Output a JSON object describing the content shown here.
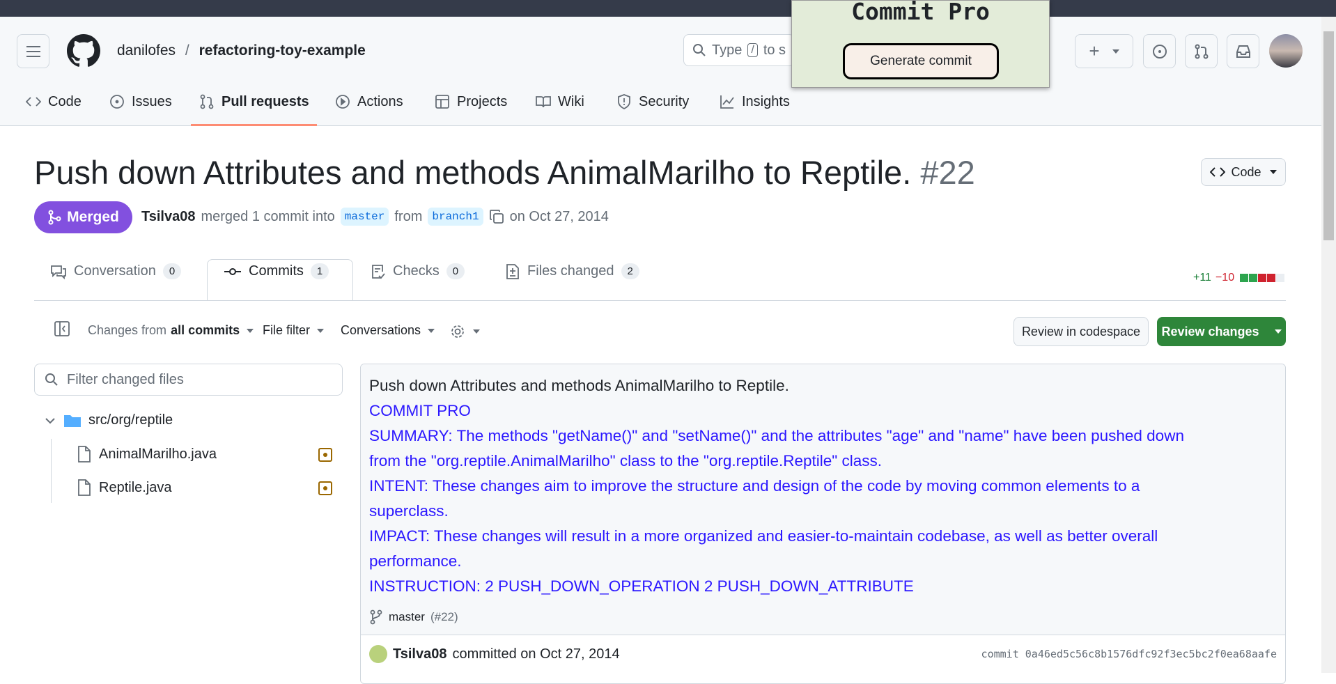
{
  "header": {
    "owner": "danilofes",
    "separator": "/",
    "repo": "refactoring-toy-example",
    "search_placeholder_a": "Type",
    "search_key": "/",
    "search_placeholder_b": "to s"
  },
  "popup": {
    "title": "Commit Pro",
    "button": "Generate commit"
  },
  "nav": [
    {
      "label": "Code",
      "icon": "code-icon"
    },
    {
      "label": "Issues",
      "icon": "issue-icon"
    },
    {
      "label": "Pull requests",
      "icon": "pull-request-icon"
    },
    {
      "label": "Actions",
      "icon": "play-icon"
    },
    {
      "label": "Projects",
      "icon": "table-icon"
    },
    {
      "label": "Wiki",
      "icon": "book-icon"
    },
    {
      "label": "Security",
      "icon": "shield-icon"
    },
    {
      "label": "Insights",
      "icon": "graph-icon"
    }
  ],
  "pr": {
    "title": "Push down Attributes and methods AnimalMarilho to Reptile.",
    "number": "#22",
    "status": "Merged",
    "author": "Tsilva08",
    "merged_text": "merged 1 commit into",
    "base": "master",
    "from": "from",
    "head": "branch1",
    "date": "on Oct 27, 2014",
    "code_button": "Code"
  },
  "tabs": [
    {
      "label": "Conversation",
      "count": "0"
    },
    {
      "label": "Commits",
      "count": "1"
    },
    {
      "label": "Checks",
      "count": "0"
    },
    {
      "label": "Files changed",
      "count": "2"
    }
  ],
  "diffstat": {
    "added": "+11",
    "removed": "−10",
    "blocks": [
      "#2da44e",
      "#2da44e",
      "#cf222e",
      "#cf222e",
      "#eaeef2"
    ]
  },
  "toolbar": {
    "changes_from": "Changes from",
    "all_commits": "all commits",
    "file_filter": "File filter",
    "conversations": "Conversations",
    "review_codespace": "Review in codespace",
    "review_changes": "Review changes"
  },
  "files": {
    "filter_placeholder": "Filter changed files",
    "folder": "src/org/reptile",
    "items": [
      "AnimalMarilho.java",
      "Reptile.java"
    ]
  },
  "commit": {
    "heading": "Push down Attributes and methods AnimalMarilho to Reptile.",
    "lines": [
      "COMMIT PRO",
      "SUMMARY: The methods \"getName()\" and \"setName()\" and the attributes \"age\" and \"name\" have been pushed down",
      "from the \"org.reptile.AnimalMarilho\" class to the \"org.reptile.Reptile\" class.",
      "INTENT: These changes aim to improve the structure and design of the code by moving common elements to a",
      "superclass.",
      "IMPACT: These changes will result in a more organized and easier-to-maintain codebase, as well as better overall",
      "performance.",
      "INSTRUCTION: 2 PUSH_DOWN_OPERATION 2 PUSH_DOWN_ATTRIBUTE"
    ],
    "branch": "master",
    "pr_ref": "(#22)",
    "author": "Tsilva08",
    "committed": "committed on Oct 27, 2014",
    "sha_label": "commit",
    "sha": "0a46ed5c56c8b1576dfc92f3ec5bc2f0ea68aafe"
  }
}
